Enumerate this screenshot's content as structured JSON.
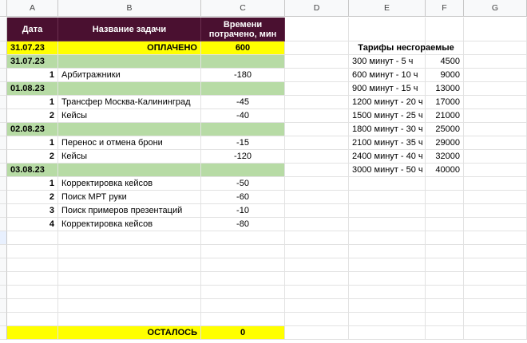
{
  "columns": [
    "A",
    "B",
    "C",
    "D",
    "E",
    "F",
    "G"
  ],
  "colors": {
    "header_bg": "#4a1030",
    "paid_bg": "#ffff00",
    "date_bg": "#b7dba5",
    "remaining_bg": "#ffff00"
  },
  "table": {
    "headers": {
      "date": "Дата",
      "task": "Название задачи",
      "time": "Времени потрачено, мин"
    },
    "paid": {
      "date": "31.07.23",
      "label": "ОПЛАЧЕНО",
      "value": "600"
    },
    "groups": [
      {
        "date": "31.07.23",
        "tasks": [
          {
            "n": "1",
            "name": "Арбитражники",
            "min": "-180"
          }
        ]
      },
      {
        "date": "01.08.23",
        "tasks": [
          {
            "n": "1",
            "name": "Трансфер Москва-Калининград",
            "min": "-45"
          },
          {
            "n": "2",
            "name": "Кейсы",
            "min": "-40"
          }
        ]
      },
      {
        "date": "02.08.23",
        "tasks": [
          {
            "n": "1",
            "name": "Перенос и отмена брони",
            "min": "-15"
          },
          {
            "n": "2",
            "name": "Кейсы",
            "min": "-120"
          }
        ]
      },
      {
        "date": "03.08.23",
        "tasks": [
          {
            "n": "1",
            "name": "Корректировка кейсов",
            "min": "-50"
          },
          {
            "n": "2",
            "name": "Поиск МРТ руки",
            "min": "-60"
          },
          {
            "n": "3",
            "name": "Поиск примеров презентаций",
            "min": "-10"
          },
          {
            "n": "4",
            "name": "Корректировка кейсов",
            "min": "-80"
          }
        ]
      }
    ],
    "remaining": {
      "label": "ОСТАЛОСЬ",
      "value": "0"
    }
  },
  "tariffs": {
    "title": "Тарифы несгораемые",
    "rows": [
      {
        "label": "300 минут - 5 ч",
        "price": "4500"
      },
      {
        "label": "600 минут - 10 ч",
        "price": "9000"
      },
      {
        "label": "900 минут - 15 ч",
        "price": "13000"
      },
      {
        "label": "1200 минут - 20 ч",
        "price": "17000"
      },
      {
        "label": "1500 минут - 25 ч",
        "price": "21000"
      },
      {
        "label": "1800 минут - 30 ч",
        "price": "25000"
      },
      {
        "label": "2100 минут - 35 ч",
        "price": "29000"
      },
      {
        "label": "2400 минут - 40 ч",
        "price": "32000"
      },
      {
        "label": "3000 минут - 50 ч",
        "price": "40000"
      }
    ]
  }
}
